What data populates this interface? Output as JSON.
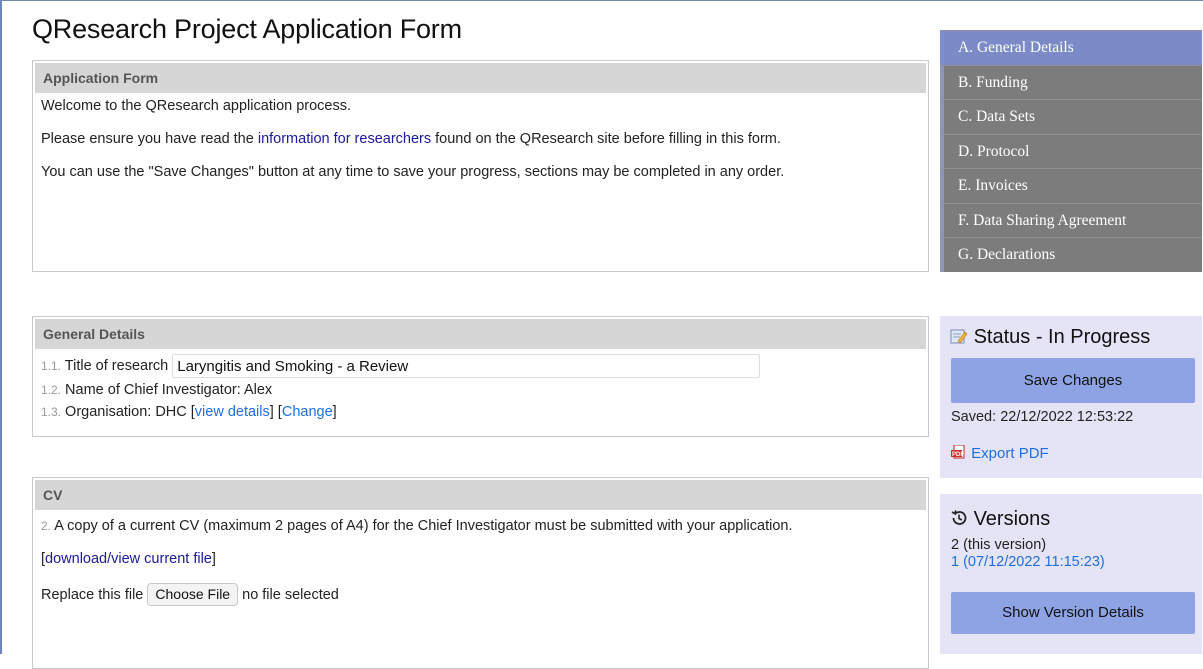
{
  "page": {
    "title": "QResearch Project Application Form"
  },
  "application_form": {
    "header": "Application Form",
    "welcome": "Welcome to the QResearch application process.",
    "ensure_prefix": "Please ensure you have read the ",
    "ensure_link": "information for researchers",
    "ensure_suffix": " found on the QResearch site before filling in this form.",
    "save_note": "You can use the \"Save Changes\" button at any time to save your progress, sections may be completed in any order."
  },
  "general_details": {
    "header": "General Details",
    "title_num": "1.1.",
    "title_label": "Title of research",
    "title_value": "Laryngitis and Smoking - a Review",
    "ci_num": "1.2.",
    "ci_text": "Name of Chief Investigator: Alex",
    "org_num": "1.3.",
    "org_text": "Organisation: DHC",
    "view_details": "view details",
    "change": "Change"
  },
  "cv": {
    "header": "CV",
    "num": "2.",
    "text": "A copy of a current CV (maximum 2 pages of A4) for the Chief Investigator must be submitted with your application.",
    "download_link": "download/view current file",
    "replace_label": "Replace this file",
    "choose_file": "Choose File",
    "no_file": "no file selected"
  },
  "nav": {
    "items": [
      {
        "label": "A. General Details"
      },
      {
        "label": "B. Funding"
      },
      {
        "label": "C. Data Sets"
      },
      {
        "label": "D. Protocol"
      },
      {
        "label": "E. Invoices"
      },
      {
        "label": "F. Data Sharing Agreement"
      },
      {
        "label": "G. Declarations"
      }
    ],
    "active_color": "#7c8bc7",
    "inactive_color": "#7c7c7c"
  },
  "status": {
    "title": "Status - In Progress",
    "save_button": "Save Changes",
    "saved_label": "Saved:",
    "saved_time": "22/12/2022 12:53:22",
    "export_pdf": "Export PDF"
  },
  "versions": {
    "title": "Versions",
    "current": "2 (this version)",
    "previous": "1 (07/12/2022 11:15:23)",
    "show_button": "Show Version Details"
  }
}
